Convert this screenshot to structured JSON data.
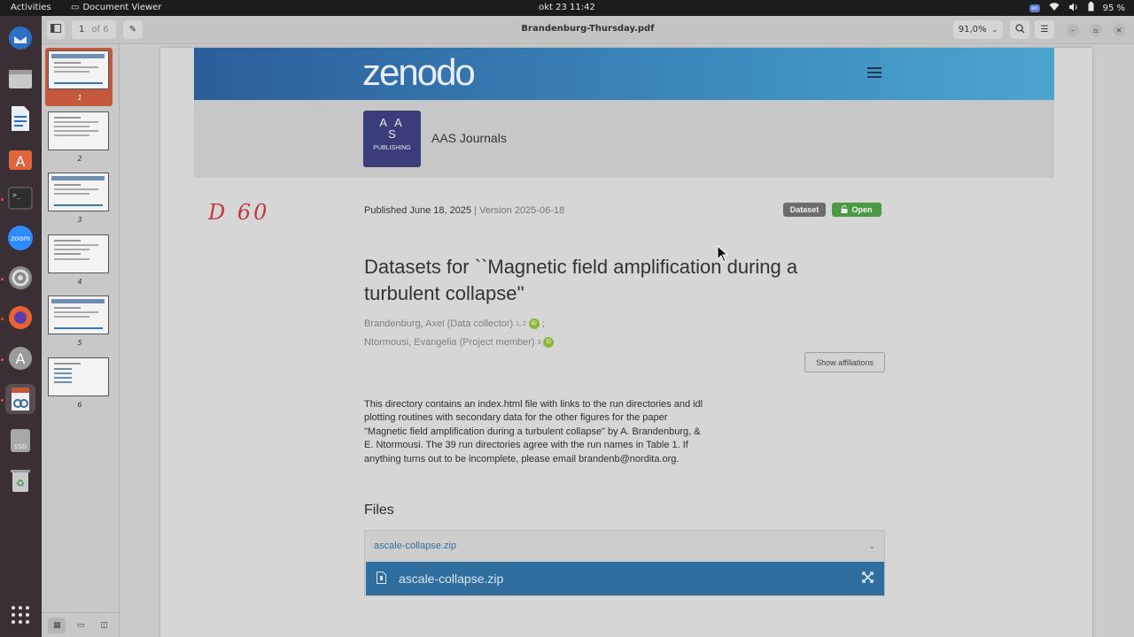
{
  "topbar": {
    "activities": "Activities",
    "app_name": "Document Viewer",
    "clock": "okt 23  11:42",
    "keyboard": "en",
    "battery": "95 %"
  },
  "dock": {
    "items": [
      "thunderbird-icon",
      "files-icon",
      "writer-icon",
      "software-center-icon",
      "terminal-icon",
      "zoom-icon",
      "settings-icon",
      "firefox-icon",
      "updater-icon",
      "document-viewer-icon",
      "ssd-drive-icon",
      "trash-icon",
      "show-apps-icon"
    ],
    "zoom_label": "zoom",
    "ssd_label": "SSD"
  },
  "viewer": {
    "page_current": "1",
    "page_of": "of 6",
    "title": "Brandenburg-Thursday.pdf",
    "zoom": "91,0%"
  },
  "thumbnails": [
    {
      "label": "1"
    },
    {
      "label": "2"
    },
    {
      "label": "3"
    },
    {
      "label": "4"
    },
    {
      "label": "5"
    },
    {
      "label": "6"
    }
  ],
  "document": {
    "logo": "zenodo",
    "community": {
      "logo_top": "A A",
      "logo_mid": "S",
      "logo_bottom": "PUBLISHING",
      "name": "AAS Journals"
    },
    "handwritten_note": "D 60",
    "published": "Published June 18, 2025",
    "version": "| Version 2025-06-18",
    "badges": {
      "dataset": "Dataset",
      "open": "Open"
    },
    "title": "Datasets for ``Magnetic field amplification during a turbulent collapse''",
    "creators": [
      {
        "name": "Brandenburg, Axel (Data collector)",
        "sup": "1, 2",
        "sep": ";"
      },
      {
        "name": "Ntormousi, Evangelia (Project member)",
        "sup": "3",
        "sep": ""
      }
    ],
    "orcid_label": "iD",
    "show_affiliations": "Show affiliations",
    "description": "This directory contains an index.html file with links to the run directories and idl plotting routines with secondary data for the other figures for the paper \"Magnetic field amplification during a turbulent collapse\" by A. Brandenburg, & E. Ntormousi. The 39 run directories agree with the run names in Table 1. If anything turns out to be incomplete, please email brandenb@nordita.org.",
    "files_heading": "Files",
    "files_accordion": "ascale-collapse.zip",
    "file_name": "ascale-collapse.zip"
  }
}
